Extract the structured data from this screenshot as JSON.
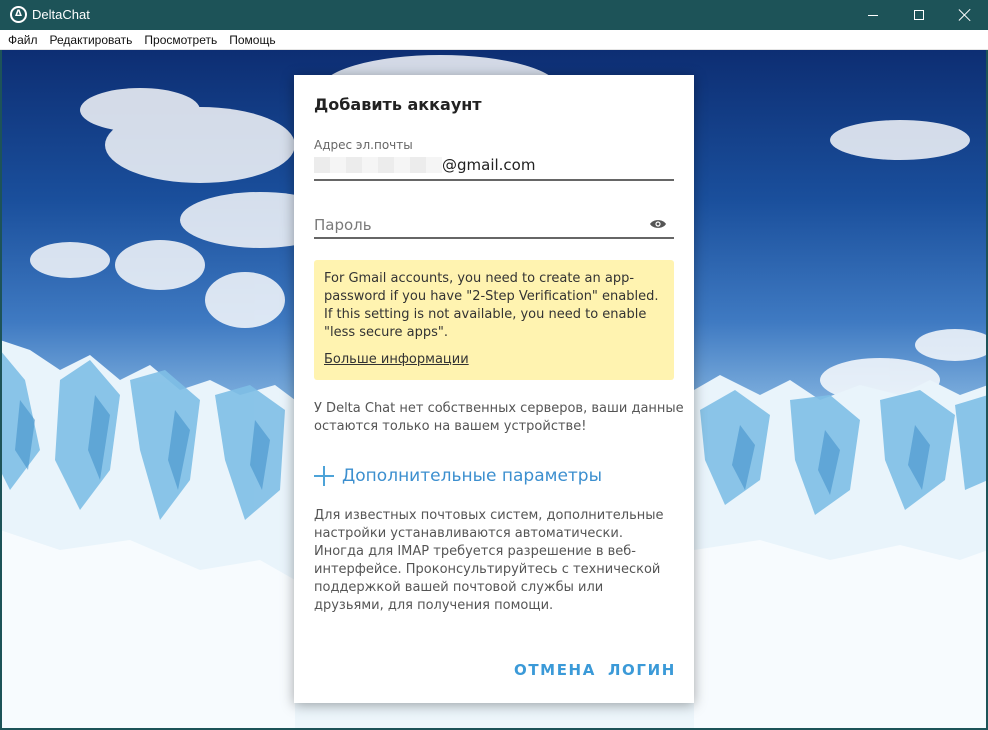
{
  "window": {
    "title": "DeltaChat"
  },
  "menu": [
    "Файл",
    "Редактировать",
    "Просмотреть",
    "Помощь"
  ],
  "dialog": {
    "title": "Добавить аккаунт",
    "email_label": "Адрес эл.почты",
    "email_value": "@gmail.com",
    "password_placeholder": "Пароль",
    "info_text": "For Gmail accounts, you need to create an app-password if you have \"2-Step Verification\" enabled. If this setting is not available, you need to enable \"less secure apps\".",
    "info_link": "Больше информации",
    "privacy_text": "У Delta Chat нет собственных серверов, ваши данные остаются только на вашем устройстве!",
    "advanced_label": "Дополнительные параметры",
    "help_text": "Для известных почтовых систем, дополнительные настройки устанавливаются автоматически. Иногда для IMAP требуется разрешение в веб-интерфейсе. Проконсультируйтесь с технической поддержкой вашей почтовой службы или друзьями, для получения помощи.",
    "cancel_label": "ОТМЕНА",
    "login_label": "ЛОГИН"
  },
  "colors": {
    "titlebar": "#1d5358",
    "accent": "#3b9ad8",
    "info_bg": "#fff3b0"
  }
}
